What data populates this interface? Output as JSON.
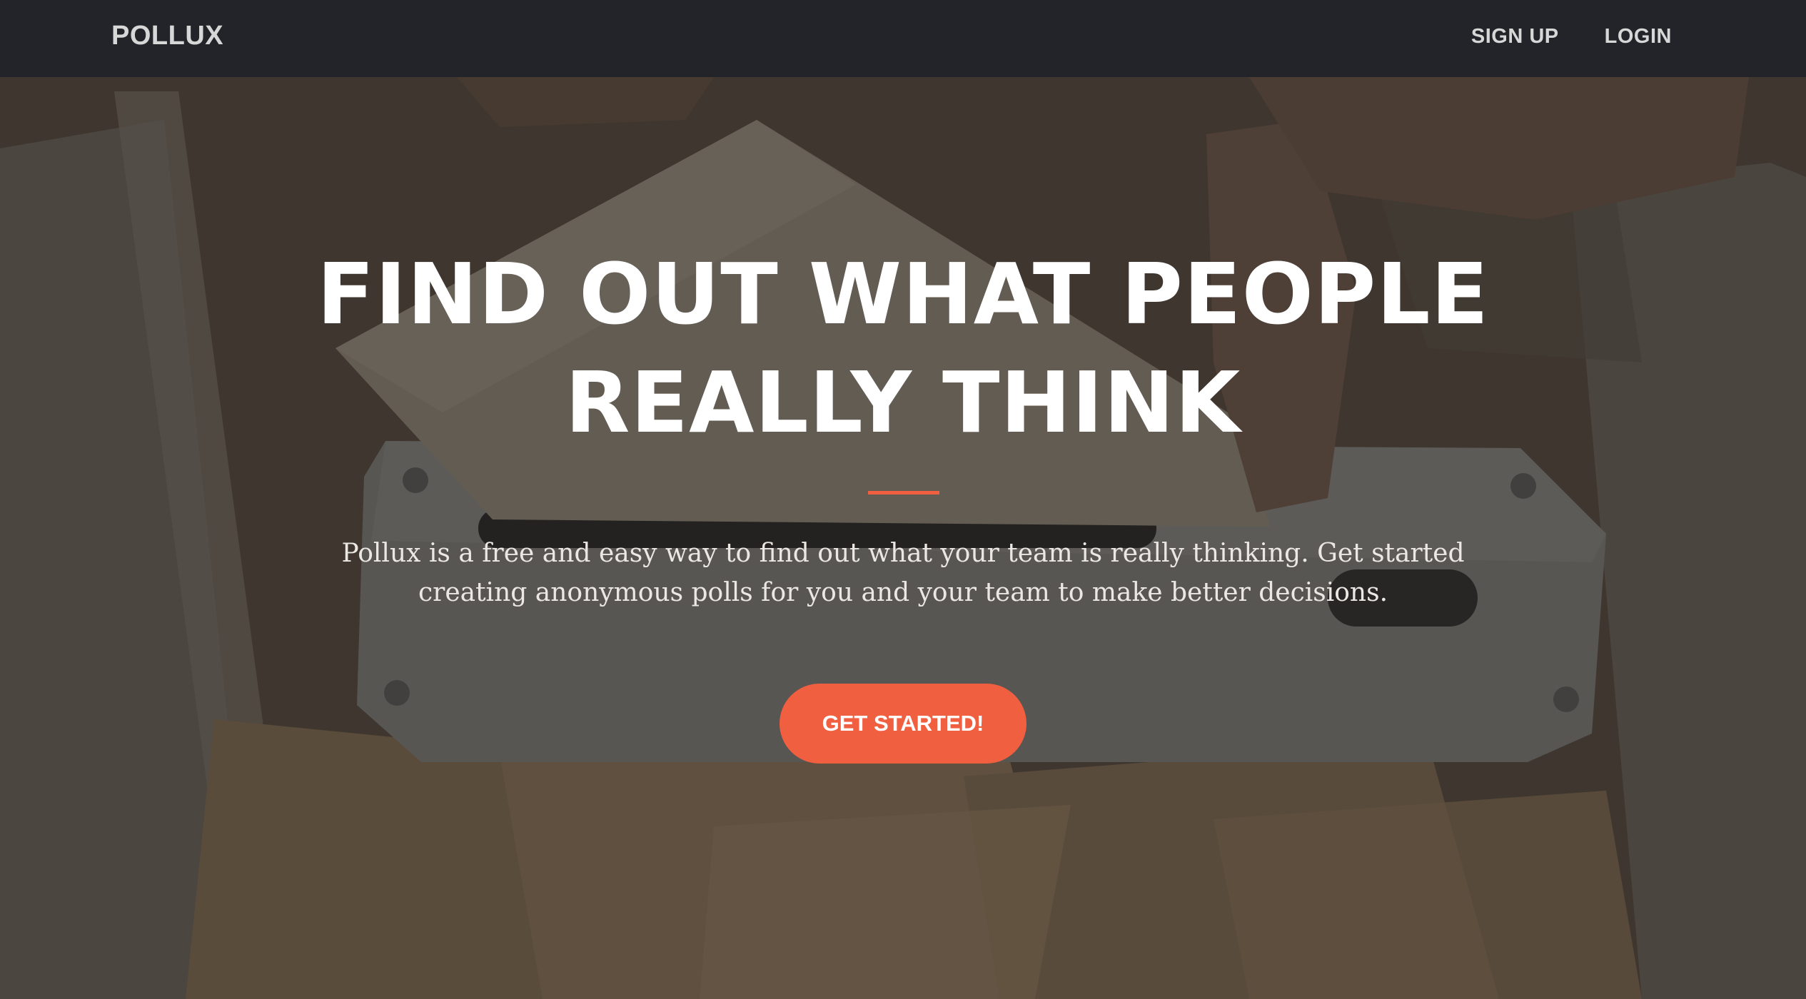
{
  "navbar": {
    "brand": "POLLUX",
    "links": [
      {
        "label": "SIGN UP"
      },
      {
        "label": "LOGIN"
      }
    ]
  },
  "hero": {
    "headline_line1": "FIND OUT WHAT PEOPLE",
    "headline_line2": "REALLY THINK",
    "lead": "Pollux is a free and easy way to find out what your team is really thinking. Get started creating anonymous polls for you and your team to make better decisions.",
    "cta_label": "GET STARTED!",
    "background": "ballot-box-photo"
  },
  "colors": {
    "navbar_bg": "#222429",
    "accent": "#f05f40",
    "text_primary": "#ffffff",
    "nav_text": "#d7d7d7"
  }
}
